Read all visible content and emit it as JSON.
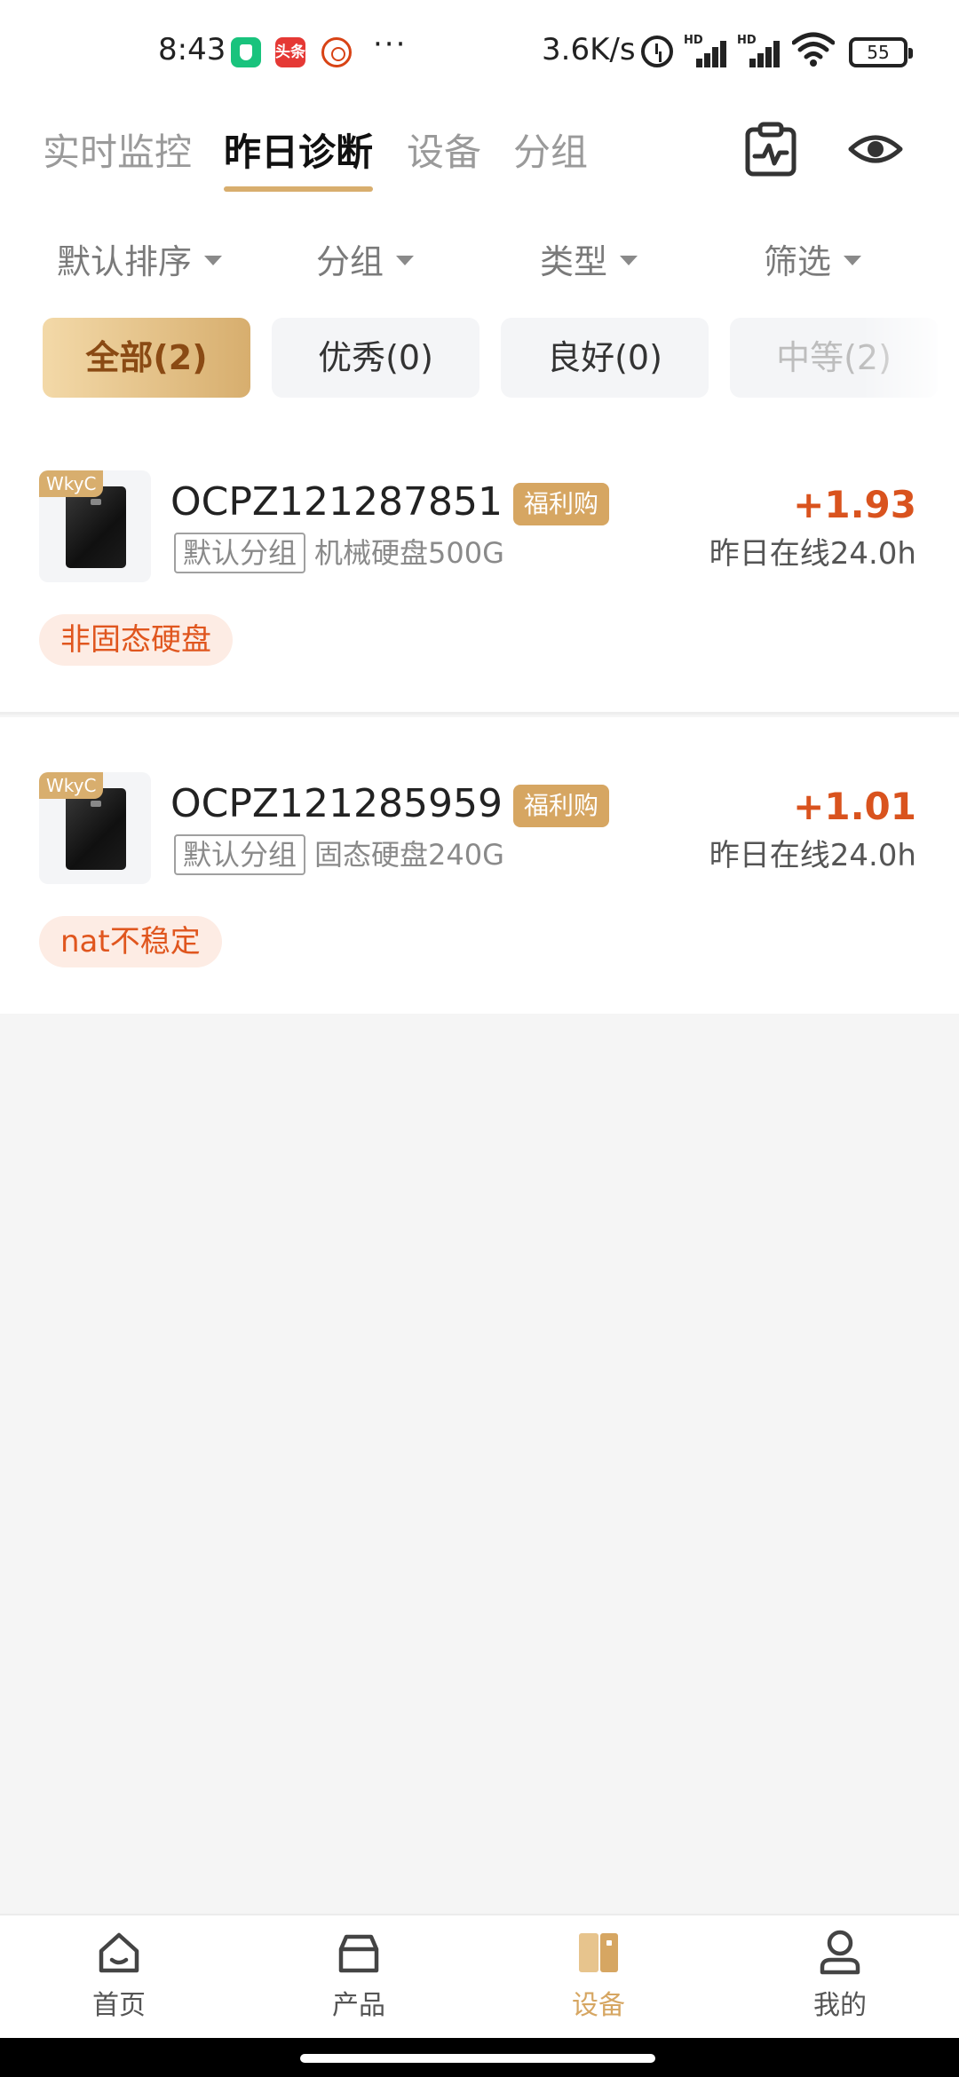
{
  "status_bar": {
    "time": "8:43",
    "more": "···",
    "net_speed": "3.6K/s",
    "hd1": "HD",
    "hd2": "HD",
    "battery": "55",
    "app2_label": "头条"
  },
  "header": {
    "tabs": [
      {
        "label": "实时监控",
        "active": false
      },
      {
        "label": "昨日诊断",
        "active": true
      },
      {
        "label": "设备",
        "active": false
      },
      {
        "label": "分组",
        "active": false
      }
    ],
    "icons": [
      "report-clipboard-icon",
      "eye-icon"
    ]
  },
  "filters": [
    {
      "label": "默认排序"
    },
    {
      "label": "分组"
    },
    {
      "label": "类型"
    },
    {
      "label": "筛选"
    }
  ],
  "status_chips": [
    {
      "label": "全部(2)",
      "selected": true
    },
    {
      "label": "优秀(0)",
      "selected": false
    },
    {
      "label": "良好(0)",
      "selected": false
    },
    {
      "label": "中等(2)",
      "selected": false
    }
  ],
  "devices": [
    {
      "badge": "WkyC",
      "name": "OCPZ121287851",
      "promo": "福利购",
      "group": "默认分组",
      "disk": "机械硬盘500G",
      "earning": "+1.93",
      "online": "昨日在线24.0h",
      "warning": "非固态硬盘"
    },
    {
      "badge": "WkyC",
      "name": "OCPZ121285959",
      "promo": "福利购",
      "group": "默认分组",
      "disk": "固态硬盘240G",
      "earning": "+1.01",
      "online": "昨日在线24.0h",
      "warning": "nat不稳定"
    }
  ],
  "bottom_nav": [
    {
      "label": "首页",
      "icon": "home-icon",
      "active": false
    },
    {
      "label": "产品",
      "icon": "bag-icon",
      "active": false
    },
    {
      "label": "设备",
      "icon": "device-icon",
      "active": true
    },
    {
      "label": "我的",
      "icon": "profile-icon",
      "active": false
    }
  ],
  "colors": {
    "accent_gold": "#d6a662",
    "earning_orange": "#d9531e",
    "warning_bg": "#fdece4"
  }
}
